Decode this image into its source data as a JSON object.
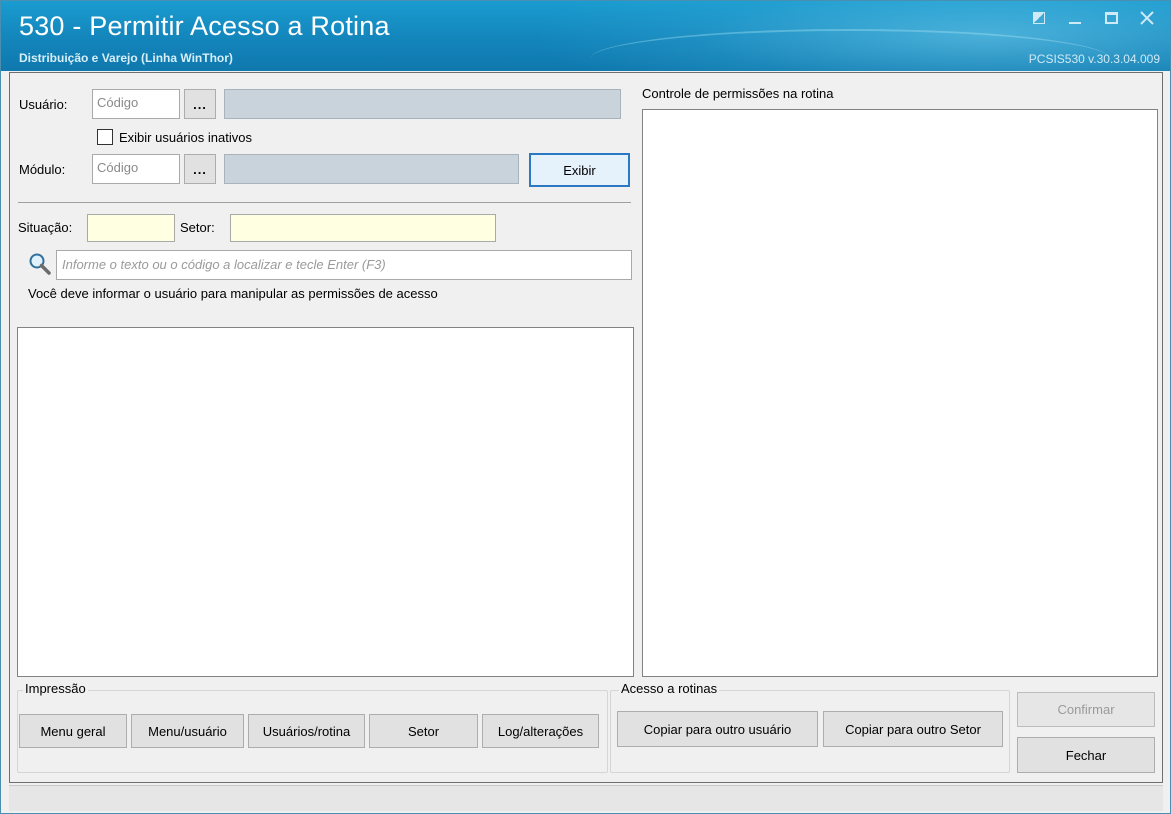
{
  "window": {
    "title": "530 - Permitir Acesso a Rotina",
    "subtitle": "Distribuição e Varejo (Linha WinThor)",
    "version": "PCSIS530  v.30.3.04.009"
  },
  "user": {
    "label": "Usuário:",
    "code_placeholder": "Código",
    "lookup_label": "...",
    "show_inactive_label": "Exibir usuários inativos",
    "show_inactive_checked": false
  },
  "module": {
    "label": "Módulo:",
    "code_placeholder": "Código",
    "lookup_label": "...",
    "show_button": "Exibir"
  },
  "filters": {
    "situacao_label": "Situação:",
    "setor_label": "Setor:",
    "search_placeholder": "Informe o texto ou o código a localizar e tecle Enter (F3)",
    "info_message": "Você deve informar o usuário para manipular as permissões de acesso"
  },
  "permissions": {
    "title": "Controle de permissões na rotina"
  },
  "impressao": {
    "title": "Impressão",
    "buttons": [
      "Menu geral",
      "Menu/usuário",
      "Usuários/rotina",
      "Setor",
      "Log/alterações"
    ]
  },
  "acesso": {
    "title": "Acesso a rotinas",
    "buttons": [
      "Copiar para outro usuário",
      "Copiar para outro Setor"
    ]
  },
  "actions": {
    "confirm": "Confirmar",
    "close": "Fechar"
  },
  "colors": {
    "titlebar": "#1385bb",
    "description_field": "#c9d3dc",
    "filter_field": "#ffffe1",
    "focus_border": "#2b78c4"
  }
}
